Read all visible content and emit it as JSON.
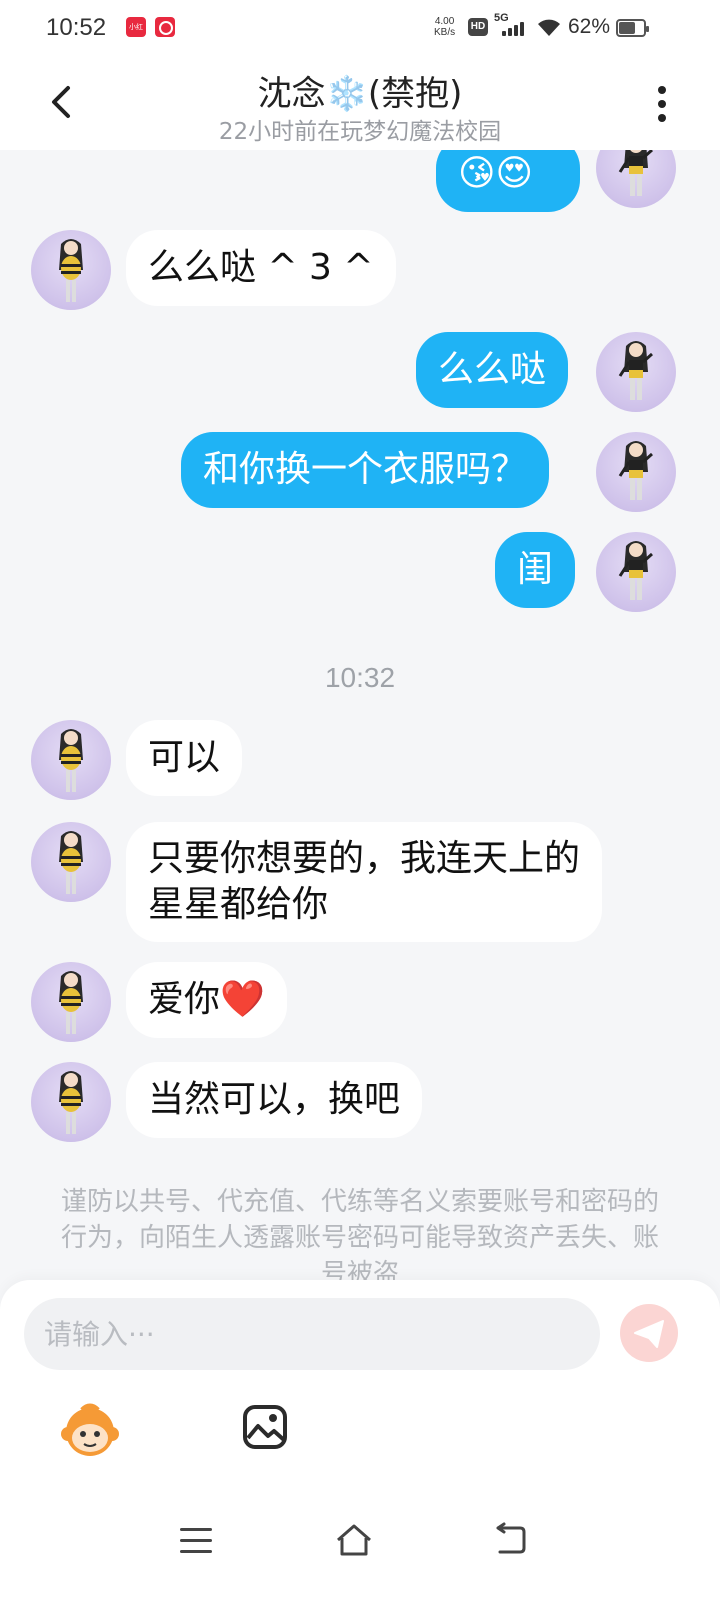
{
  "status_bar": {
    "time": "10:52",
    "app_badge_1": "小红书",
    "speed_value": "4.00",
    "speed_unit": "KB/s",
    "hd": "HD",
    "network": "5G",
    "battery": "62%"
  },
  "header": {
    "title": "沈念❄️(禁抱)",
    "subtitle": "22小时前在玩梦幻魔法校园"
  },
  "messages": [
    {
      "side": "right",
      "text": "😘😍"
    },
    {
      "side": "left",
      "text": "么么哒 ^ 3 ^"
    },
    {
      "side": "right",
      "text": "么么哒"
    },
    {
      "side": "right",
      "text": "和你换一个衣服吗？"
    },
    {
      "side": "right",
      "text": "闺"
    },
    {
      "side": "left",
      "text": "可以"
    },
    {
      "side": "left",
      "text": "只要你想要的，我连天上的星星都给你"
    },
    {
      "side": "left",
      "text": "爱你",
      "emoji": "❤️"
    },
    {
      "side": "left",
      "text": "当然可以，换吧"
    }
  ],
  "timestamp": "10:32",
  "warning": "谨防以共号、代充值、代练等名义索要账号和密码的行为，向陌生人透露账号密码可能导致资产丢失、账号被盗",
  "input": {
    "placeholder": "请输入···",
    "value": ""
  },
  "colors": {
    "accent": "#1fb3f5",
    "background": "#f5f6f8",
    "send_disabled": "#fbd5d3"
  },
  "icons": {
    "back": "chevron-left-icon",
    "more": "more-vertical-icon",
    "send": "send-icon",
    "emoji": "monkey-emoji-icon",
    "image": "image-icon"
  }
}
